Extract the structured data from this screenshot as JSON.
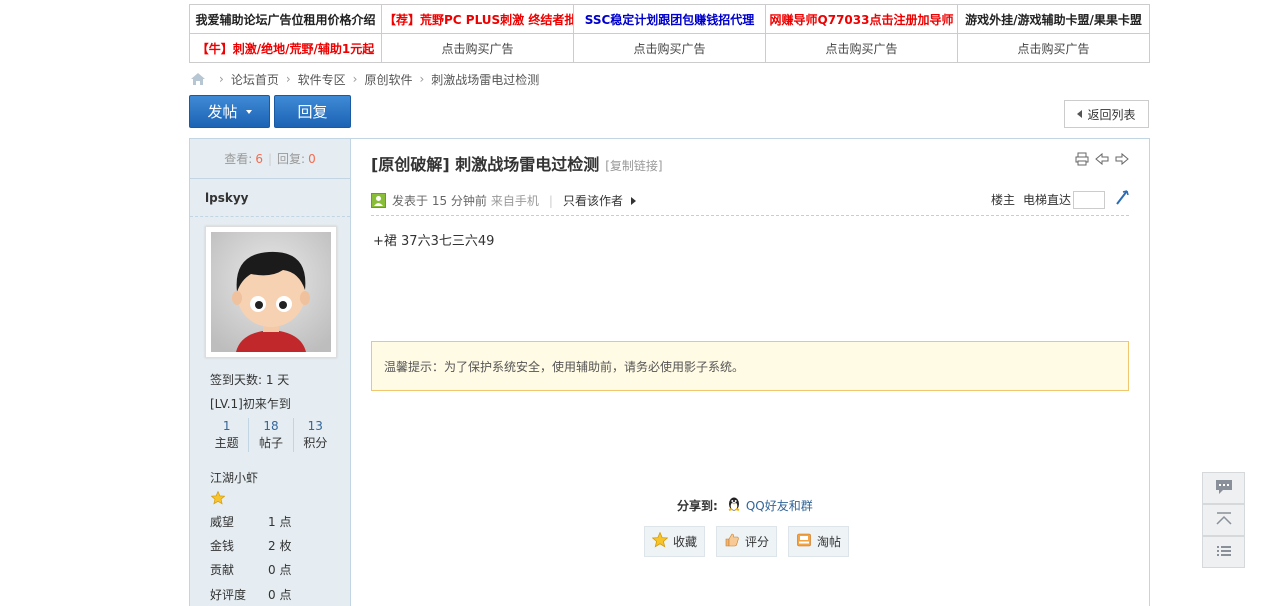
{
  "ads": {
    "row1": [
      {
        "text": "我爱辅助论坛广告位租用价格介绍",
        "style": "black"
      },
      {
        "text": "【荐】荒野PC PLUS刺激 终结者批",
        "style": "red"
      },
      {
        "text": "SSC稳定计划跟团包赚钱招代理",
        "style": "blue"
      },
      {
        "text": "网赚导师Q77033点击注册加导师",
        "style": "red"
      },
      {
        "text": "游戏外挂/游戏辅助卡盟/果果卡盟",
        "style": "black"
      }
    ],
    "row2": [
      {
        "text": "【牛】刺激/绝地/荒野/辅助1元起",
        "style": "red"
      },
      {
        "text": "点击购买广告",
        "style": "plain"
      },
      {
        "text": "点击购买广告",
        "style": "plain"
      },
      {
        "text": "点击购买广告",
        "style": "plain"
      },
      {
        "text": "点击购买广告",
        "style": "plain"
      }
    ]
  },
  "breadcrumb": [
    "论坛首页",
    "软件专区",
    "原创软件",
    "刺激战场雷电过检测"
  ],
  "buttons": {
    "post": "发帖",
    "reply": "回复",
    "back": "返回列表"
  },
  "thread": {
    "views_label": "查看:",
    "views": "6",
    "replies_label": "回复:",
    "replies": "0",
    "title": "[原创破解] 刺激战场雷电过检测",
    "copy_link": "[复制链接]"
  },
  "author": {
    "name": "lpskyy",
    "checkin": "签到天数: 1 天",
    "level": "[LV.1]初来乍到",
    "stats": [
      {
        "value": "1",
        "label": "主题"
      },
      {
        "value": "18",
        "label": "帖子"
      },
      {
        "value": "13",
        "label": "积分"
      }
    ],
    "rank": "江湖小虾",
    "props": [
      {
        "key": "威望",
        "value": "1 点"
      },
      {
        "key": "金钱",
        "value": "2 枚"
      },
      {
        "key": "贡献",
        "value": "0 点"
      },
      {
        "key": "好评度",
        "value": "0 点"
      }
    ]
  },
  "post": {
    "posted_at": "发表于 15 分钟前",
    "source": "来自手机",
    "only_author": "只看该作者",
    "floor": "楼主",
    "jump_label": "电梯直达",
    "body": "+裙 37六3七三六49",
    "notice": "温馨提示：为了保护系统安全，使用辅助前，请务必使用影子系统。"
  },
  "share": {
    "label": "分享到:",
    "qq": "QQ好友和群"
  },
  "actions": {
    "favorite": "收藏",
    "rate": "评分",
    "tao": "淘帖"
  },
  "colors": {
    "accent": "#1c63b4",
    "count": "#f26c4f",
    "link": "#336699"
  }
}
